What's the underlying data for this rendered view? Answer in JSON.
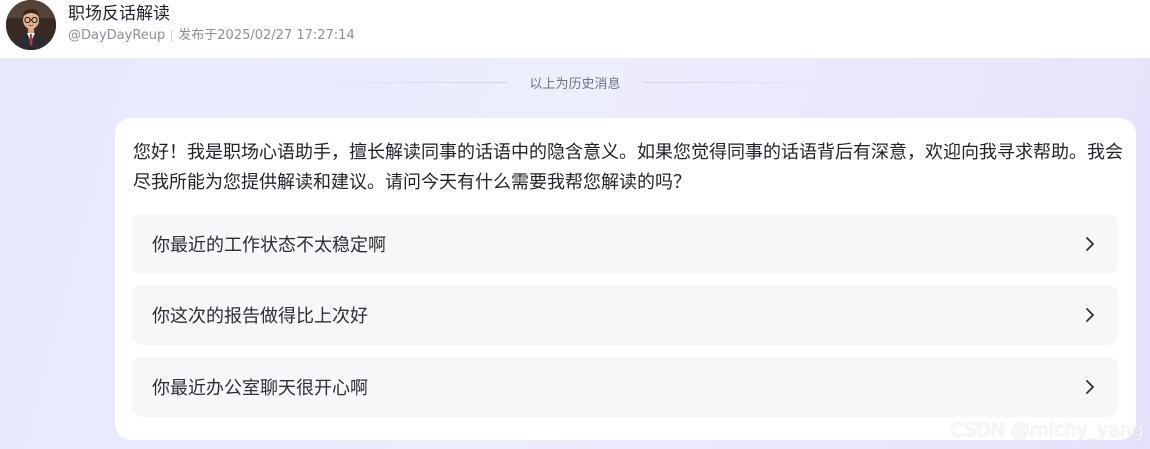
{
  "header": {
    "title": "职场反话解读",
    "author": "@DayDayReup",
    "published": "发布于2025/02/27 17:27:14"
  },
  "history_divider": "以上为历史消息",
  "message": {
    "greeting": "您好！我是职场心语助手，擅长解读同事的话语中的隐含意义。如果您觉得同事的话语背后有深意，欢迎向我寻求帮助。我会尽我所能为您提供解读和建议。请问今天有什么需要我帮您解读的吗？",
    "suggestions": [
      {
        "label": "你最近的工作状态不太稳定啊"
      },
      {
        "label": "你这次的报告做得比上次好"
      },
      {
        "label": "你最近办公室聊天很开心啊"
      }
    ]
  },
  "watermark": "CSDN @michy_yang",
  "colors": {
    "title": "#1f2329",
    "meta": "#8a8f99",
    "background_from": "#e6e9fd",
    "background_to": "#e6e2fc",
    "bubble": "#ffffff",
    "suggestion_bg": "#f6f7f9"
  },
  "icons": {
    "suggestion_arrow": "chevron-right-icon"
  }
}
